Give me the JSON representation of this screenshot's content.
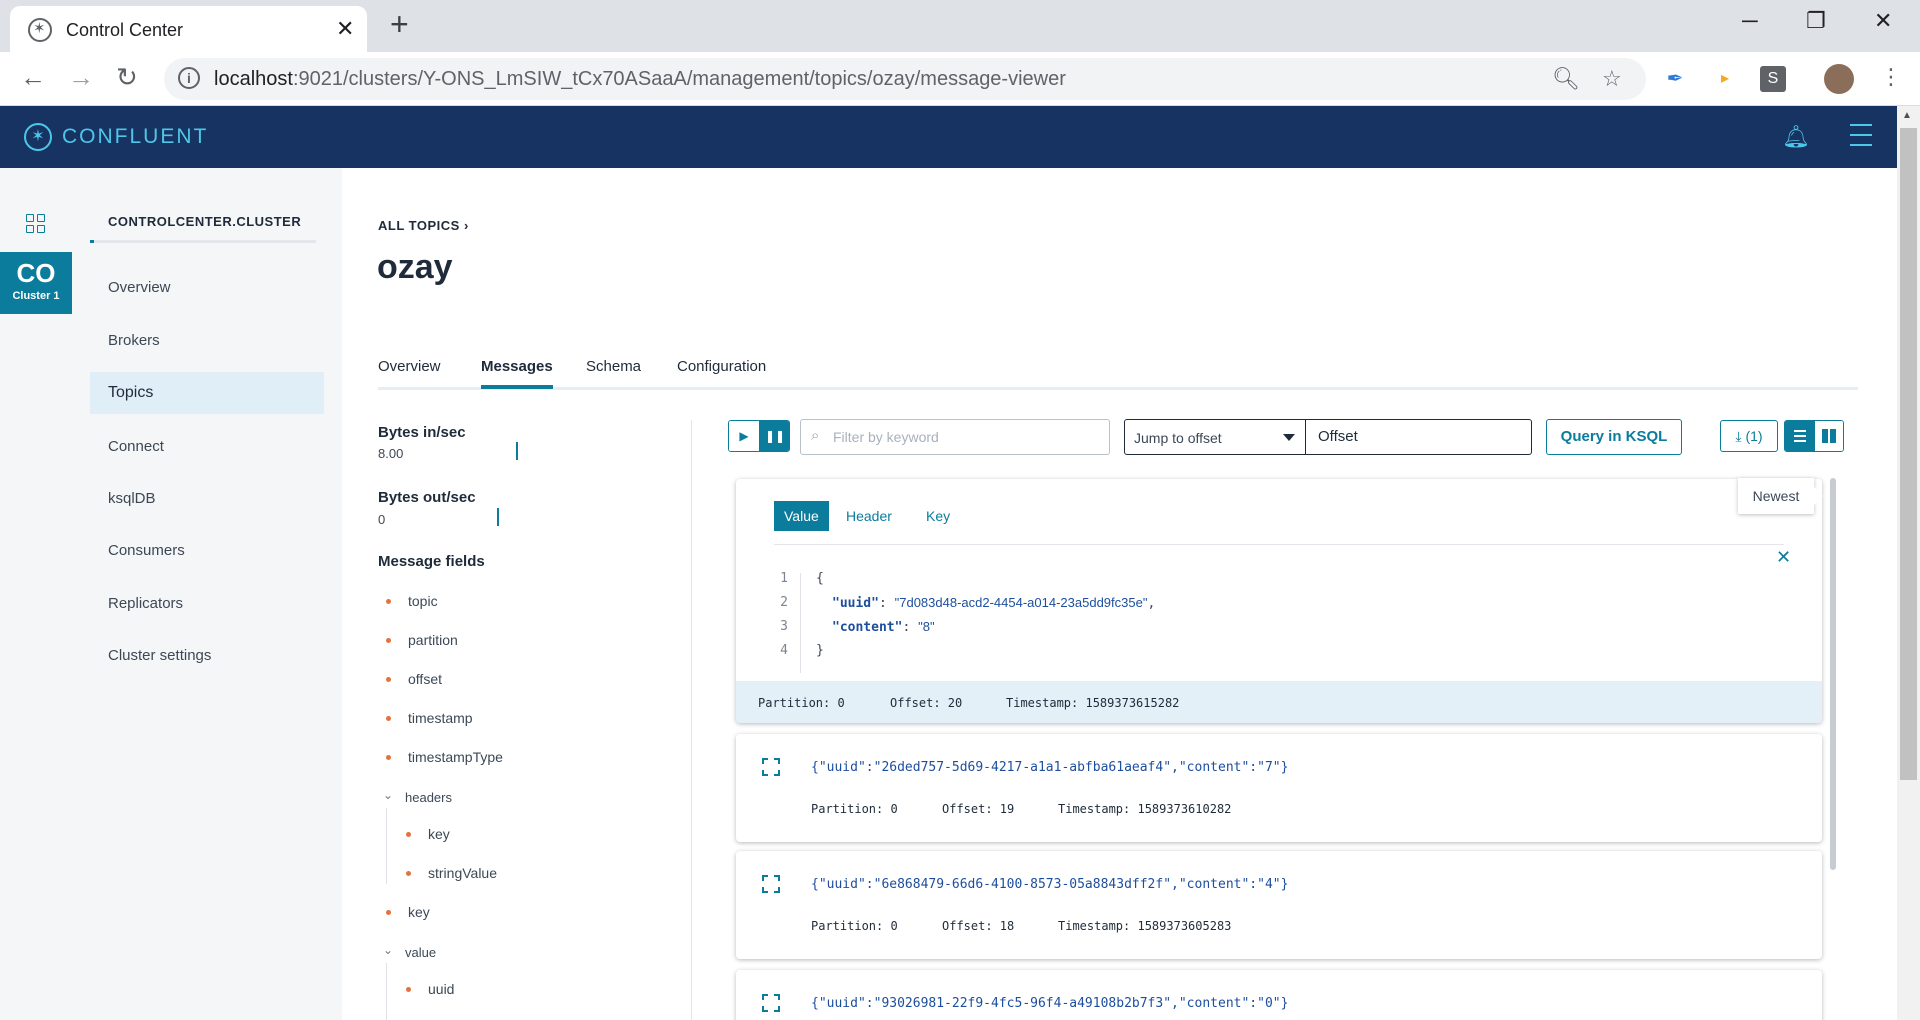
{
  "browser": {
    "tab_title": "Control Center",
    "url_host": "localhost",
    "url_path": ":9021/clusters/Y-ONS_LmSIW_tCx70ASaaA/management/topics/ozay/message-viewer",
    "ext_s_label": "S"
  },
  "app": {
    "brand": "CONFLUENT"
  },
  "rail": {
    "cluster_short": "CO",
    "cluster_label": "Cluster 1"
  },
  "sidenav": {
    "cluster_name": "CONTROLCENTER.CLUSTER",
    "items": [
      {
        "label": "Overview"
      },
      {
        "label": "Brokers"
      },
      {
        "label": "Topics"
      },
      {
        "label": "Connect"
      },
      {
        "label": "ksqlDB"
      },
      {
        "label": "Consumers"
      },
      {
        "label": "Replicators"
      },
      {
        "label": "Cluster settings"
      }
    ]
  },
  "main": {
    "breadcrumb": "ALL TOPICS",
    "title": "ozay",
    "tabs": [
      {
        "label": "Overview"
      },
      {
        "label": "Messages"
      },
      {
        "label": "Schema"
      },
      {
        "label": "Configuration"
      }
    ]
  },
  "stats": {
    "bytes_in_label": "Bytes in/sec",
    "bytes_in_value": "8.00",
    "bytes_out_label": "Bytes out/sec",
    "bytes_out_value": "0"
  },
  "fields": {
    "title": "Message fields",
    "items": [
      "topic",
      "partition",
      "offset",
      "timestamp",
      "timestampType"
    ],
    "headers_group": "headers",
    "headers_items": [
      "key",
      "stringValue"
    ],
    "key": "key",
    "value_group": "value",
    "value_items": [
      "uuid"
    ]
  },
  "controls": {
    "filter_placeholder": "Filter by keyword",
    "jump_label": "Jump to offset",
    "offset_placeholder": "Offset",
    "ksql_label": "Query in KSQL",
    "download_label": "(1)"
  },
  "messages": {
    "newest_label": "Newest",
    "subtabs": [
      "Value",
      "Header",
      "Key"
    ],
    "expanded": {
      "line_numbers": [
        "1",
        "2",
        "3",
        "4"
      ],
      "open_brace": "{",
      "uuid_key": "\"uuid\"",
      "uuid_value": "\"7d083d48-acd2-4454-a014-23a5dd9fc35e\"",
      "content_key": "\"content\"",
      "content_value": "\"8\"",
      "close_brace": "}",
      "partition": "Partition: 0",
      "offset": "Offset: 20",
      "timestamp": "Timestamp: 1589373615282"
    },
    "rows": [
      {
        "json": "{\"uuid\":\"26ded757-5d69-4217-a1a1-abfba61aeaf4\",\"content\":\"7\"}",
        "partition": "Partition: 0",
        "offset": "Offset: 19",
        "timestamp": "Timestamp: 1589373610282"
      },
      {
        "json": "{\"uuid\":\"6e868479-66d6-4100-8573-05a8843dff2f\",\"content\":\"4\"}",
        "partition": "Partition: 0",
        "offset": "Offset: 18",
        "timestamp": "Timestamp: 1589373605283"
      },
      {
        "json": "{\"uuid\":\"93026981-22f9-4fc5-96f4-a49108b2b7f3\",\"content\":\"0\"}"
      }
    ]
  }
}
